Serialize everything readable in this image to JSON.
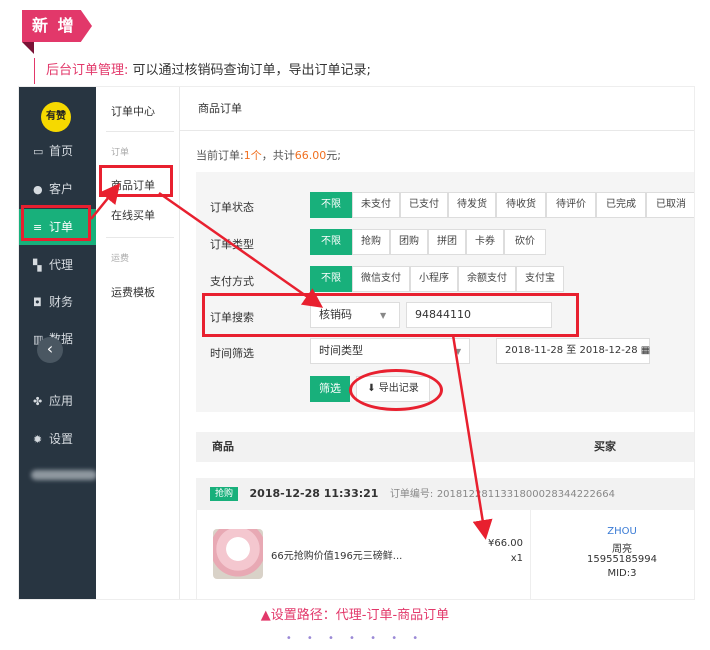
{
  "badge": {
    "label": "新 增"
  },
  "intro": {
    "highlight": "后台订单管理:",
    "text": "可以通过核销码查询订单，导出订单记录;"
  },
  "sidebar": {
    "logo_text": "有赞",
    "items": [
      {
        "icon": "monitor-icon",
        "label": "首页"
      },
      {
        "icon": "user-icon",
        "label": "客户"
      },
      {
        "icon": "list-icon",
        "label": "订单"
      },
      {
        "icon": "map-icon",
        "label": "代理"
      },
      {
        "icon": "camera-icon",
        "label": "财务"
      },
      {
        "icon": "bar-chart-icon",
        "label": "数据"
      },
      {
        "icon": "apps-icon",
        "label": "应用"
      },
      {
        "icon": "gear-icon",
        "label": "设置"
      }
    ],
    "collapse_glyph": "‹"
  },
  "submenu": {
    "title": "订单中心",
    "group1": "订单",
    "item1": "商品订单",
    "item2": "在线买单",
    "group2": "运费",
    "item3": "运费模板"
  },
  "main": {
    "header": "商品订单",
    "current_prefix": "当前订单:",
    "current_count": "1个",
    "current_mid": "，共计",
    "current_amount": "66.00",
    "current_suffix": "元;",
    "filters": {
      "status_label": "订单状态",
      "status_options": [
        "不限",
        "未支付",
        "已支付",
        "待发货",
        "待收货",
        "待评价",
        "已完成",
        "已取消"
      ],
      "type_label": "订单类型",
      "type_options": [
        "不限",
        "抢购",
        "团购",
        "拼团",
        "卡券",
        "砍价"
      ],
      "pay_label": "支付方式",
      "pay_options": [
        "不限",
        "微信支付",
        "小程序",
        "余额支付",
        "支付宝"
      ],
      "search_label": "订单搜索",
      "search_select": "核销码",
      "search_value": "94844110",
      "time_label": "时间筛选",
      "time_select": "时间类型",
      "date_range": "2018-11-28 至 2018-12-28"
    },
    "filter_button": "筛选",
    "export_button": "导出记录",
    "table": {
      "col_product": "商品",
      "col_buyer": "买家",
      "order": {
        "tag": "抢购",
        "datetime": "2018-12-28 11:33:21",
        "number_label": "订单编号:",
        "number": "20181228113318000283442226​64",
        "product_name": "66元抢购价值196元三磅鲜...",
        "price": "¥66.00",
        "qty": "x1",
        "buyer_nick": "ZHOU",
        "buyer_name": "周亮",
        "buyer_phone": "15955185994",
        "buyer_mid": "MID:3"
      }
    }
  },
  "caption": "▲设置路径：代理-订单-商品订单",
  "dots": "• • • • • • •",
  "colors": {
    "accent": "#18b07b",
    "sidebar": "#283541",
    "pink": "#e2386a",
    "annotation": "#e8202f"
  }
}
